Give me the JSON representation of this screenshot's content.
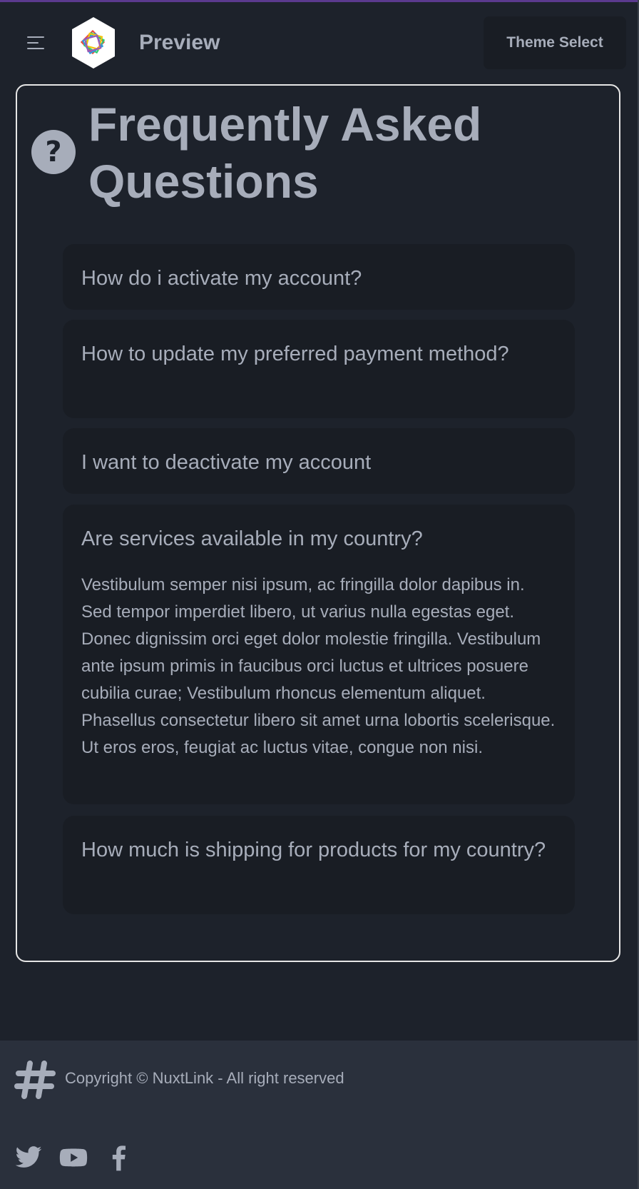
{
  "header": {
    "brand_title": "Preview",
    "theme_select_label": "Theme Select"
  },
  "faq": {
    "title": "Frequently Asked Questions",
    "items": [
      {
        "question": "How do i activate my account?"
      },
      {
        "question": "How to update my preferred payment method?"
      },
      {
        "question": "I want to deactivate my account"
      },
      {
        "question": "Are services available in my country?",
        "answer": "Vestibulum semper nisi ipsum, ac fringilla dolor dapibus in. Sed tempor imperdiet libero, ut varius nulla egestas eget. Donec dignissim orci eget dolor molestie fringilla. Vestibulum ante ipsum primis in faucibus orci luctus et ultrices posuere cubilia curae; Vestibulum rhoncus elementum aliquet. Phasellus consectetur libero sit amet urna lobortis scelerisque. Ut eros eros, feugiat ac luctus vitae, congue non nisi."
      },
      {
        "question": "How much is shipping for products for my country?"
      }
    ]
  },
  "footer": {
    "copyright": "Copyright © NuxtLink - All right reserved",
    "icons": [
      "hash-icon",
      "twitter-icon",
      "youtube-icon",
      "facebook-icon"
    ]
  },
  "colors": {
    "background": "#1d222b",
    "card": "#191d24",
    "footer": "#2a303c",
    "text": "#a7adba",
    "accent_stripe": "#5b3a8e"
  }
}
